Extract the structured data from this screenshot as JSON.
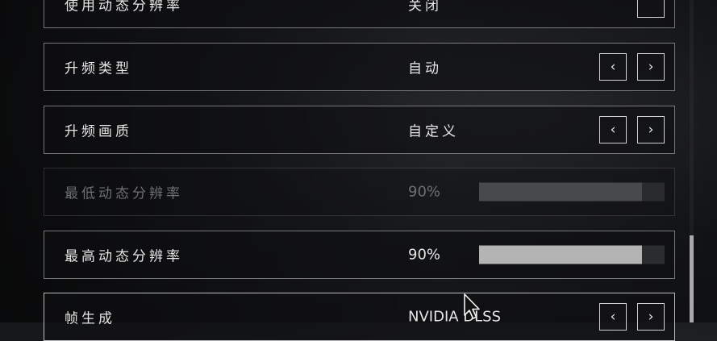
{
  "settings": [
    {
      "label": "使用动态分辨率",
      "value": "关闭",
      "control": "checkbox",
      "enabled": true
    },
    {
      "label": "升频类型",
      "value": "自动",
      "control": "arrows",
      "enabled": true
    },
    {
      "label": "升频画质",
      "value": "自定义",
      "control": "arrows",
      "enabled": true
    },
    {
      "label": "最低动态分辨率",
      "value": "90%",
      "control": "slider",
      "enabled": false,
      "level": 0.88
    },
    {
      "label": "最高动态分辨率",
      "value": "90%",
      "control": "slider",
      "enabled": true,
      "level": 0.88
    },
    {
      "label": "帧生成",
      "value": "NVIDIA DLSS",
      "control": "arrows",
      "enabled": true
    }
  ],
  "arrows": {
    "prev": "‹",
    "next": "›"
  },
  "icons": {
    "cursor": "mouse-pointer-icon"
  },
  "colors": {
    "text": "#e6e6e6",
    "disabled_text": "#6d6f73",
    "border": "#d2d2d2",
    "slider_fill": "#b4b4b4"
  }
}
